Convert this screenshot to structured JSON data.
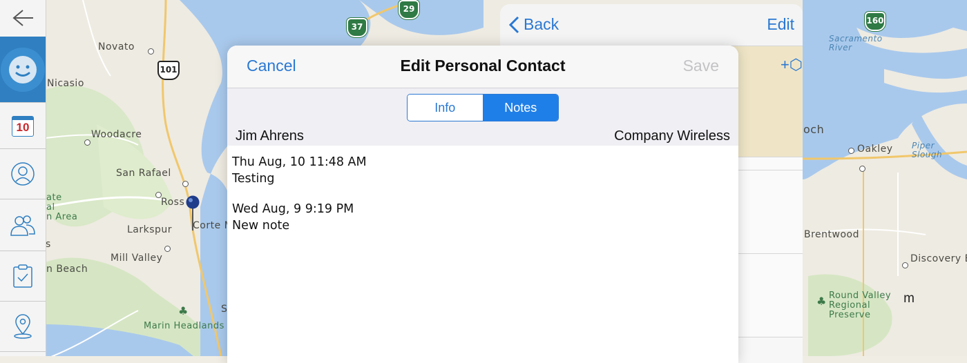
{
  "map": {
    "places": {
      "novato": "Novato",
      "nicasio": "Nicasio",
      "woodacre": "Woodacre",
      "san_rafael": "San Rafael",
      "ross": "Ross",
      "larkspur": "Larkspur",
      "corte_madera": "Corte M",
      "mill_valley": "Mill Valley",
      "beach": "n Beach",
      "marin_headlands": "Marin Headlands",
      "gate_park": "ate\nal\nn Area",
      "oakley": "Oakley",
      "brentwood": "Brentwood",
      "discovery_bay": "Discovery B",
      "och": "och",
      "s_frag": "s",
      "s2_frag": "S"
    },
    "water": {
      "sacramento_river": "Sacramento\nRiver",
      "piper_slough": "Piper\nSlough"
    },
    "parks": {
      "round_valley": "Round Valley\nRegional\nPreserve"
    },
    "shields": {
      "hwy_29": "29",
      "hwy_37": "37",
      "us_101": "101",
      "hwy_160": "160"
    }
  },
  "sidebar": {
    "calendar_day": "10"
  },
  "panel": {
    "back_label": "Back",
    "edit_label": "Edit",
    "add_icon": "+⬡",
    "fragment": "m"
  },
  "modal": {
    "cancel_label": "Cancel",
    "title": "Edit Personal Contact",
    "save_label": "Save",
    "tabs": [
      {
        "label": "Info",
        "selected": false
      },
      {
        "label": "Notes",
        "selected": true
      }
    ],
    "contact_name": "Jim Ahrens",
    "company": "Company Wireless",
    "notes": [
      {
        "date": "Thu Aug, 10 11:48 AM",
        "text": "Testing"
      },
      {
        "date": "Wed Aug, 9 9:19 PM",
        "text": "New note"
      }
    ]
  },
  "colors": {
    "accent": "#2a78d3",
    "sidebar_active": "#2f7fc1",
    "segment_selected": "#1f7fe8",
    "disabled": "#c3c3c6"
  }
}
